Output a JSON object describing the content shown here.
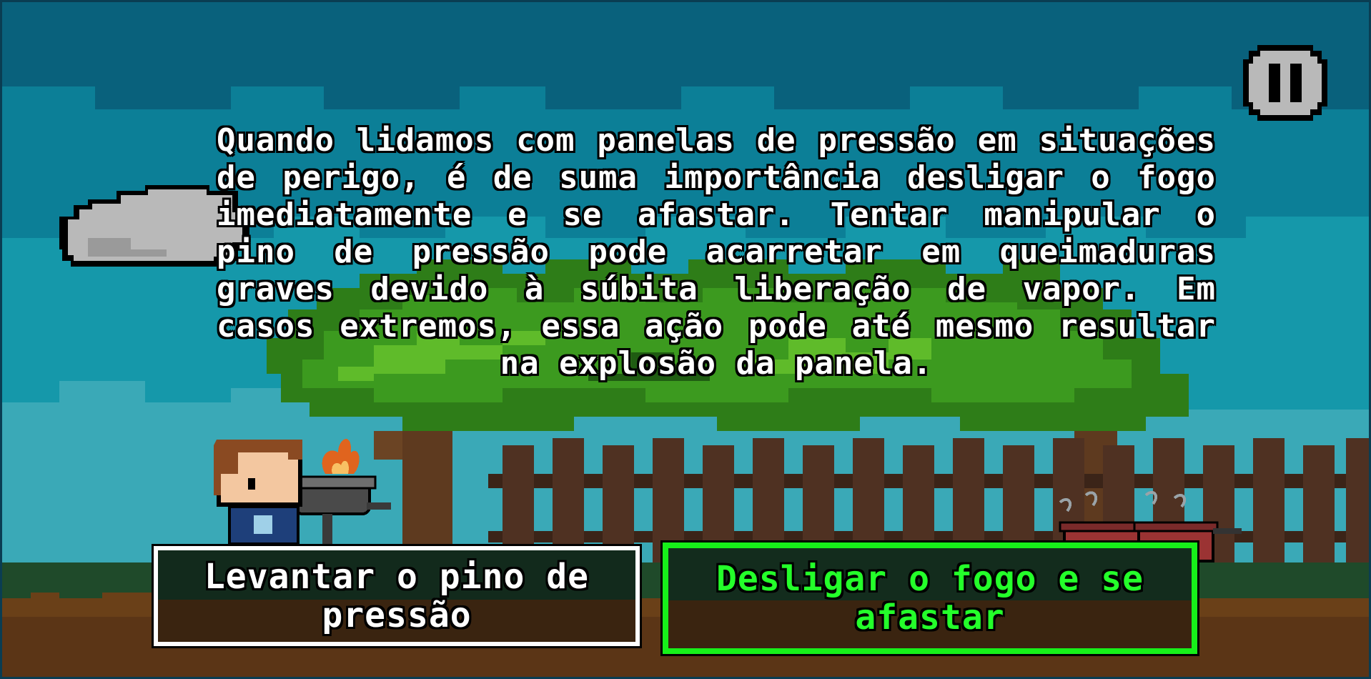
{
  "scene": {
    "story_text": "Quando lidamos com panelas de pressão em situações de perigo, é de suma importância desligar o fogo imediatamente e se afastar. Tentar manipular o pino de pressão pode acarretar em queimaduras graves devido à súbita liberação de vapor. Em casos extremos, essa ação pode até mesmo resultar na explosão da panela."
  },
  "choices": [
    {
      "label": "Levantar o pino de pressão",
      "selected": false
    },
    {
      "label": "Desligar o fogo e se afastar",
      "selected": true
    }
  ],
  "hud": {
    "pause_icon": "pause-icon"
  },
  "colors": {
    "sky_dark": "#09617c",
    "sky_mid": "#0e889d",
    "sky_light": "#38a8b7",
    "grass": "#1f4a2a",
    "dirt": "#5b3516",
    "choice_selected_border": "#17f01a",
    "choice_default_border": "#ffffff",
    "text": "#ffffff",
    "selected_text": "#24ff2a"
  }
}
